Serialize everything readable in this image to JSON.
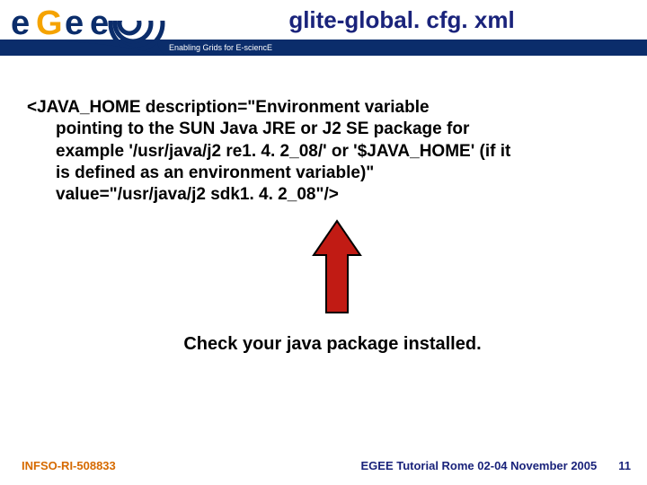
{
  "header": {
    "title": "glite-global. cfg. xml",
    "tagline": "Enabling Grids for E-sciencE"
  },
  "body": {
    "xml_line1": "<JAVA_HOME description=\"Environment variable",
    "xml_line2": "pointing to the SUN Java JRE or J2 SE package for",
    "xml_line3": "example '/usr/java/j2 re1. 4. 2_08/' or '$JAVA_HOME' (if it",
    "xml_line4": "is defined as an environment variable)\"",
    "xml_line5": "value=\"/usr/java/j2 sdk1. 4. 2_08\"/>",
    "check_text": "Check your java package installed."
  },
  "footer": {
    "left": "INFSO-RI-508833",
    "mid": "EGEE Tutorial Rome 02-04 November 2005",
    "page": "11"
  }
}
